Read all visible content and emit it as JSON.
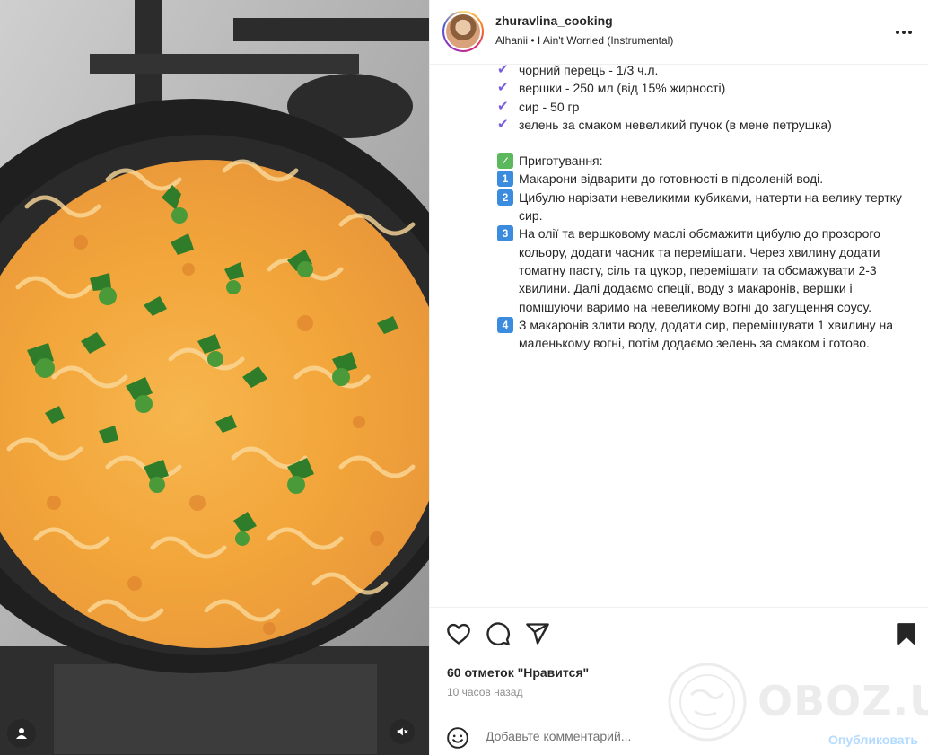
{
  "post": {
    "username": "zhuravlina_cooking",
    "audio": "Alhanii • I Ain't Worried (Instrumental)",
    "more_icon": "more-horizontal-icon"
  },
  "caption": {
    "ingredients": [
      "чорний перець - 1/3 ч.л.",
      "вершки - 250 мл (від 15% жирності)",
      "сир - 50 гр",
      "зелень за смаком невеликий пучок (в мене петрушка)"
    ],
    "prep_heading": "Приготування:",
    "steps": [
      {
        "num": "1",
        "text": "Макарони відварити до готовності в підсоленій воді."
      },
      {
        "num": "2",
        "text": "Цибулю нарізати невеликими кубиками, натерти на велику тертку сир."
      },
      {
        "num": "3",
        "text": "На олії та вершковому маслі обсмажити цибулю до прозорого кольору, додати часник та перемішати. Через хвилину додати томатну пасту, сіль та цукор, перемішати та обсмажувати 2-3 хвилини. Далі додаємо спеції, воду з макаронів, вершки і помішуючи варимо на невеликому вогні до загущення соусу."
      },
      {
        "num": "4",
        "text": "З макаронів злити воду, додати сир, перемішувати 1 хвилину на маленькому вогні, потім додаємо зелень за смаком і готово."
      }
    ],
    "check_color": "#7b5ce0"
  },
  "actions": {
    "likes": "60 отметок \"Нравится\"",
    "time": "10 часов назад"
  },
  "comment": {
    "placeholder": "Добавьте комментарий...",
    "post_label": "Опубликовать"
  },
  "watermark": {
    "text": "OBOZ.UA"
  },
  "colors": {
    "link_disabled": "#b3dbff",
    "secondary_text": "#8e8e8e",
    "border": "#efefef"
  }
}
